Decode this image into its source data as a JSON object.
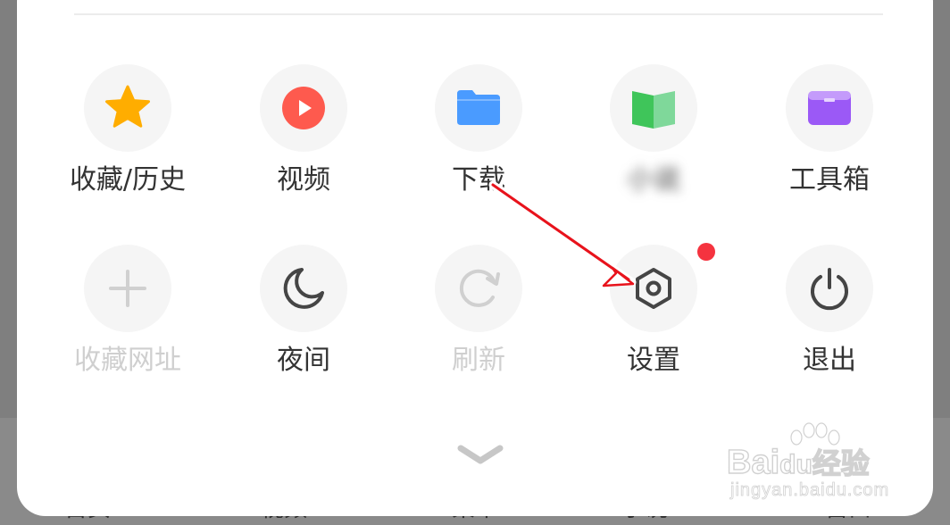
{
  "background_nav": {
    "items": [
      "首页",
      "视频",
      "菜单",
      "小说",
      "窗口"
    ]
  },
  "menu": {
    "row1": [
      {
        "label": "收藏/历史",
        "icon": "star-icon"
      },
      {
        "label": "视频",
        "icon": "video-play-icon"
      },
      {
        "label": "下载",
        "icon": "folder-icon"
      },
      {
        "label": "小说",
        "icon": "book-icon"
      },
      {
        "label": "工具箱",
        "icon": "toolbox-icon"
      }
    ],
    "row2": [
      {
        "label": "收藏网址",
        "icon": "plus-icon",
        "disabled": true
      },
      {
        "label": "夜间",
        "icon": "moon-icon"
      },
      {
        "label": "刷新",
        "icon": "refresh-icon",
        "disabled": true
      },
      {
        "label": "设置",
        "icon": "settings-hexagon-icon",
        "badge": true
      },
      {
        "label": "退出",
        "icon": "power-icon"
      }
    ],
    "collapse_icon": "chevron-down-icon"
  },
  "colors": {
    "star": "#ffad00",
    "video": "#fe5a4e",
    "folder": "#4a9bff",
    "book": "#3fc55a",
    "toolbox": "#9b59f6",
    "badge": "#f5333f",
    "annotation": "#e8131c"
  },
  "watermark": {
    "brand": "Bai",
    "brand2": "du",
    "cn": "经验",
    "url": "jingyan.baidu.com"
  }
}
